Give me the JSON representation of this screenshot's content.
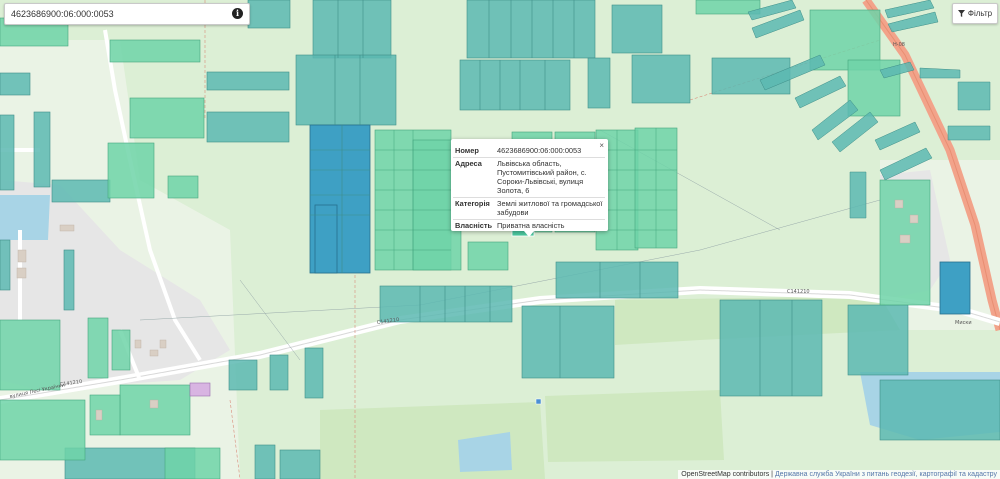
{
  "search": {
    "value": "4623686900:06:000:0053"
  },
  "filter": {
    "label": "Фільтр",
    "icon": "filter-icon"
  },
  "popup": {
    "close": "×",
    "rows": [
      {
        "key": "Номер",
        "value": "4623686900:06:000:0053"
      },
      {
        "key": "Адреса",
        "value": "Львівська область, Пустомитівський район, с. Сороки-Львівські, вулиця Золота, 6"
      },
      {
        "key": "Категорія",
        "value": "Землі житлової та громадської забудови"
      },
      {
        "key": "Власність",
        "value": "Приватна власність"
      }
    ]
  },
  "map_labels": {
    "road_right": "С141210",
    "road_mid": "С141210",
    "road_left": "С141210",
    "street": "вулиця Лесі Українки",
    "highway": "Н-08",
    "bottom_right": "Миски"
  },
  "attribution": {
    "osm": "OpenStreetMap contributors",
    "separator": "|",
    "gov": "Державна служба України з питань геодезії, картографії та кадастру"
  },
  "colors": {
    "background": "#dcefd5",
    "parcel_teal": "#5cb8b2",
    "parcel_green": "#6fd3a8",
    "parcel_blue": "#3ea0c4",
    "road": "#ffffff",
    "highway": "#f0a58a"
  }
}
